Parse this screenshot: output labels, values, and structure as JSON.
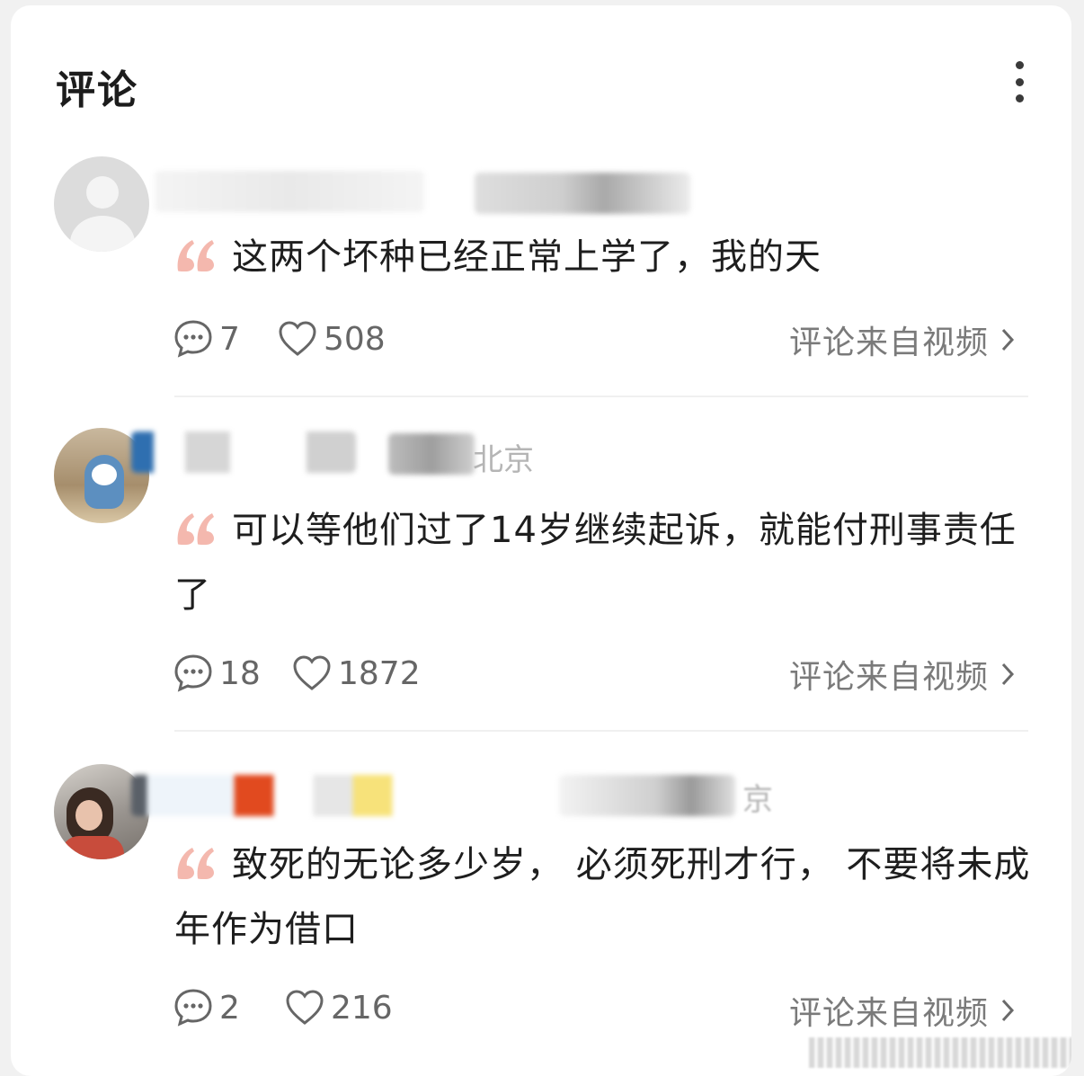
{
  "header": {
    "title": "评论"
  },
  "icons": {
    "more": "more-vertical-icon",
    "reply": "comment-bubble-icon",
    "like": "heart-icon",
    "quote": "quote-mark-icon",
    "chevron": "chevron-right-icon"
  },
  "colors": {
    "quote": "#f4b8ae",
    "meta_text": "#7a7a7a",
    "location": "#b5b5b5"
  },
  "comments": [
    {
      "location": "",
      "text": "这两个坏种已经正常上学了，我的天",
      "replies": "7",
      "likes": "508",
      "source_link": "评论来自视频"
    },
    {
      "location": "北京",
      "text": "可以等他们过了14岁继续起诉，就能付刑事责任了",
      "replies": "18",
      "likes": "1872",
      "source_link": "评论来自视频"
    },
    {
      "location": "京",
      "text": "致死的无论多少岁， 必须死刑才行， 不要将未成年作为借口",
      "replies": "2",
      "likes": "216",
      "source_link": "评论来自视频"
    }
  ]
}
